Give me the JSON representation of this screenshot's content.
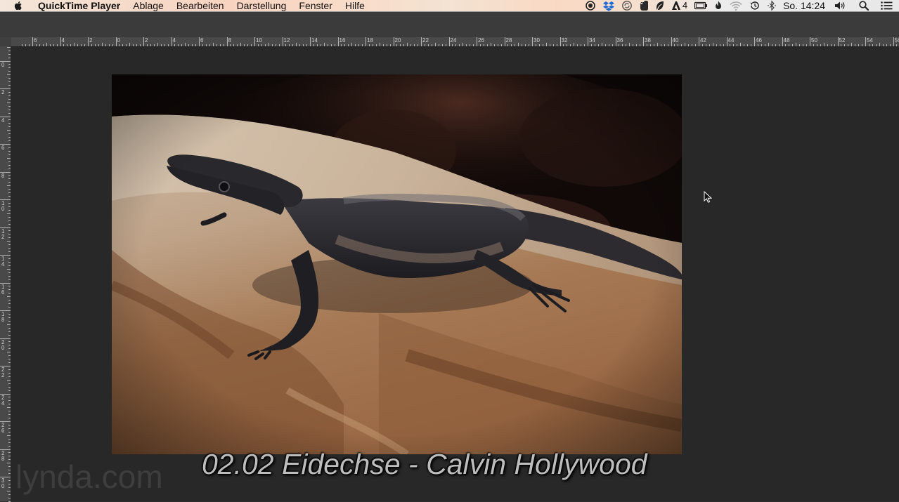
{
  "menubar": {
    "app_name": "QuickTime Player",
    "menus": [
      "Ablage",
      "Bearbeiten",
      "Darstellung",
      "Fenster",
      "Hilfe"
    ],
    "tray_icons": [
      "record-icon",
      "dropbox-icon",
      "sync-icon",
      "evernote-icon",
      "leaf-icon",
      "adobe-icon",
      "battery-icon",
      "flame-icon",
      "wifi-icon",
      "time-machine-icon",
      "bluetooth-icon"
    ],
    "adobe_count": "4",
    "clock": "So. 14:24",
    "right_icons": [
      "volume-icon",
      "spotlight-icon",
      "notification-list-icon"
    ]
  },
  "ruler": {
    "horizontal_labels": [
      "6",
      "4",
      "2",
      "0",
      "2",
      "4",
      "6",
      "8",
      "10",
      "12",
      "14",
      "16",
      "18",
      "20",
      "22",
      "24",
      "26",
      "28",
      "30",
      "32",
      "34",
      "36",
      "38",
      "40",
      "42",
      "44",
      "46",
      "48",
      "50",
      "52",
      "54",
      "56"
    ],
    "vertical_labels": [
      "2",
      "0",
      "2",
      "4",
      "6",
      "8",
      "10",
      "12",
      "14",
      "16",
      "18",
      "20",
      "22",
      "24",
      "26",
      "28",
      "30"
    ]
  },
  "photo": {
    "subject": "lizard-photo"
  },
  "caption": "02.02 Eidechse - Calvin Hollywood",
  "watermark": "lynda.com"
}
